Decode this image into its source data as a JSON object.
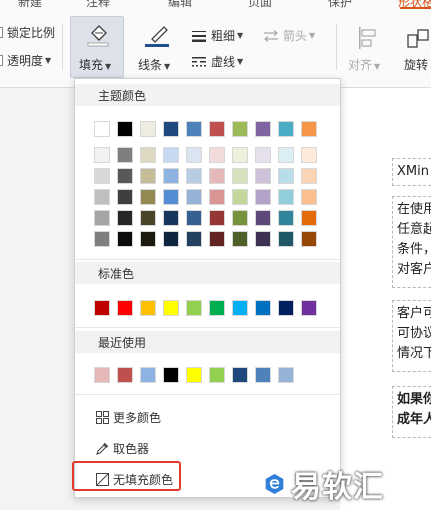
{
  "ribbon": {
    "top_tabs": [
      {
        "label": "新建",
        "active": false
      },
      {
        "label": "注释",
        "active": false
      },
      {
        "label": "编辑",
        "active": false
      },
      {
        "label": "页面",
        "active": false
      },
      {
        "label": "保护",
        "active": false
      },
      {
        "label": "形状格式",
        "active": true
      }
    ],
    "lock_ratio_label": "锁定比例",
    "transparency_label": "透明度",
    "fill_label": "填充",
    "line_label": "线条",
    "thickness_label": "粗细",
    "dash_label": "虚线",
    "arrow_label": "箭头",
    "align_label": "对齐",
    "rotate_label": "旋转"
  },
  "dropdown": {
    "theme_title": "主题颜色",
    "standard_title": "标准色",
    "recent_title": "最近使用",
    "theme_row_top": [
      "#ffffff",
      "#000000",
      "#eeece1",
      "#1f497d",
      "#4f81bd",
      "#c0504d",
      "#9bbb59",
      "#8064a2",
      "#4bacc6",
      "#f79646"
    ],
    "theme_shades": [
      [
        "#f2f2f2",
        "#7f7f7f",
        "#ddd9c3",
        "#c6d9f0",
        "#dbe5f1",
        "#f2dcdb",
        "#ebf1dd",
        "#e5e0ec",
        "#dbeef3",
        "#fdeada"
      ],
      [
        "#d8d8d8",
        "#595959",
        "#c4bd97",
        "#8db3e2",
        "#b8cce4",
        "#e5b9b7",
        "#d7e3bc",
        "#ccc1d9",
        "#b7dde8",
        "#fbd5b5"
      ],
      [
        "#bfbfbf",
        "#3f3f3f",
        "#938953",
        "#548dd4",
        "#95b3d7",
        "#d99694",
        "#c3d69b",
        "#b2a2c7",
        "#92cddc",
        "#fac08f"
      ],
      [
        "#a5a5a5",
        "#262626",
        "#494429",
        "#17365d",
        "#366092",
        "#953734",
        "#76923c",
        "#5f497a",
        "#31859b",
        "#e36c09"
      ],
      [
        "#7f7f7f",
        "#0c0c0c",
        "#1d1b10",
        "#0f243e",
        "#244061",
        "#632423",
        "#4f6128",
        "#3f3151",
        "#205867",
        "#974806"
      ]
    ],
    "standard_colors": [
      "#c00000",
      "#ff0000",
      "#ffc000",
      "#ffff00",
      "#92d050",
      "#00b050",
      "#00b0f0",
      "#0070c0",
      "#002060",
      "#7030a0"
    ],
    "recent_colors": [
      "#e6b8b7",
      "#c0504d",
      "#8db3e2",
      "#000000",
      "#ffff00",
      "#92d050",
      "#1f497d",
      "#4f81bd",
      "#95b3d7"
    ],
    "more_colors_label": "更多颜色",
    "eyedropper_label": "取色器",
    "no_fill_label": "无填充颜色"
  },
  "document": {
    "lines": [
      [
        "XMin"
      ],
      [
        "在使用",
        "任意起",
        "条件，",
        "对客户"
      ],
      [
        "客户可",
        "可协议",
        "情况下"
      ],
      [
        "如果你",
        "成年人"
      ]
    ]
  },
  "watermark": {
    "text": "易软汇"
  },
  "colors": {
    "accent": "#d6541a",
    "highlight": "#e23b2e"
  }
}
